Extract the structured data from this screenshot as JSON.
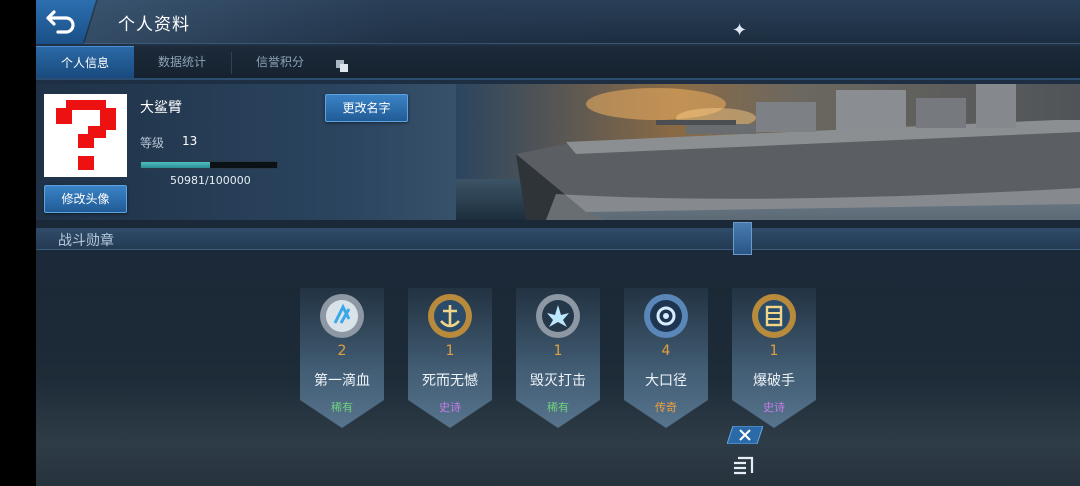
{
  "header": {
    "title": "个人资料"
  },
  "tabs": [
    {
      "label": "个人信息",
      "active": true
    },
    {
      "label": "数据统计",
      "active": false
    },
    {
      "label": "信誉积分",
      "active": false
    }
  ],
  "profile": {
    "name": "大鲨臂",
    "level_label": "等级",
    "level": "13",
    "xp_text": "50981/100000",
    "xp_fraction": 0.50981,
    "change_avatar_label": "修改头像",
    "change_name_label": "更改名字"
  },
  "medals_section": {
    "title": "战斗勋章"
  },
  "medals": [
    {
      "count": "2",
      "name": "第一滴血",
      "rarity": "稀有",
      "rarity_color": "#6fd07a",
      "icon": "silver-arrow-medal-icon"
    },
    {
      "count": "1",
      "name": "死而无憾",
      "rarity": "史诗",
      "rarity_color": "#c77be8",
      "icon": "anchor-medal-icon"
    },
    {
      "count": "1",
      "name": "毁灭打击",
      "rarity": "稀有",
      "rarity_color": "#6fd07a",
      "icon": "explosion-medal-icon"
    },
    {
      "count": "4",
      "name": "大口径",
      "rarity": "传奇",
      "rarity_color": "#f2a23a",
      "icon": "large-caliber-medal-icon"
    },
    {
      "count": "1",
      "name": "爆破手",
      "rarity": "史诗",
      "rarity_color": "#c77be8",
      "icon": "demolition-medal-icon"
    }
  ],
  "colors": {
    "accent": "#2a6aa6",
    "count": "#e3a03c"
  }
}
